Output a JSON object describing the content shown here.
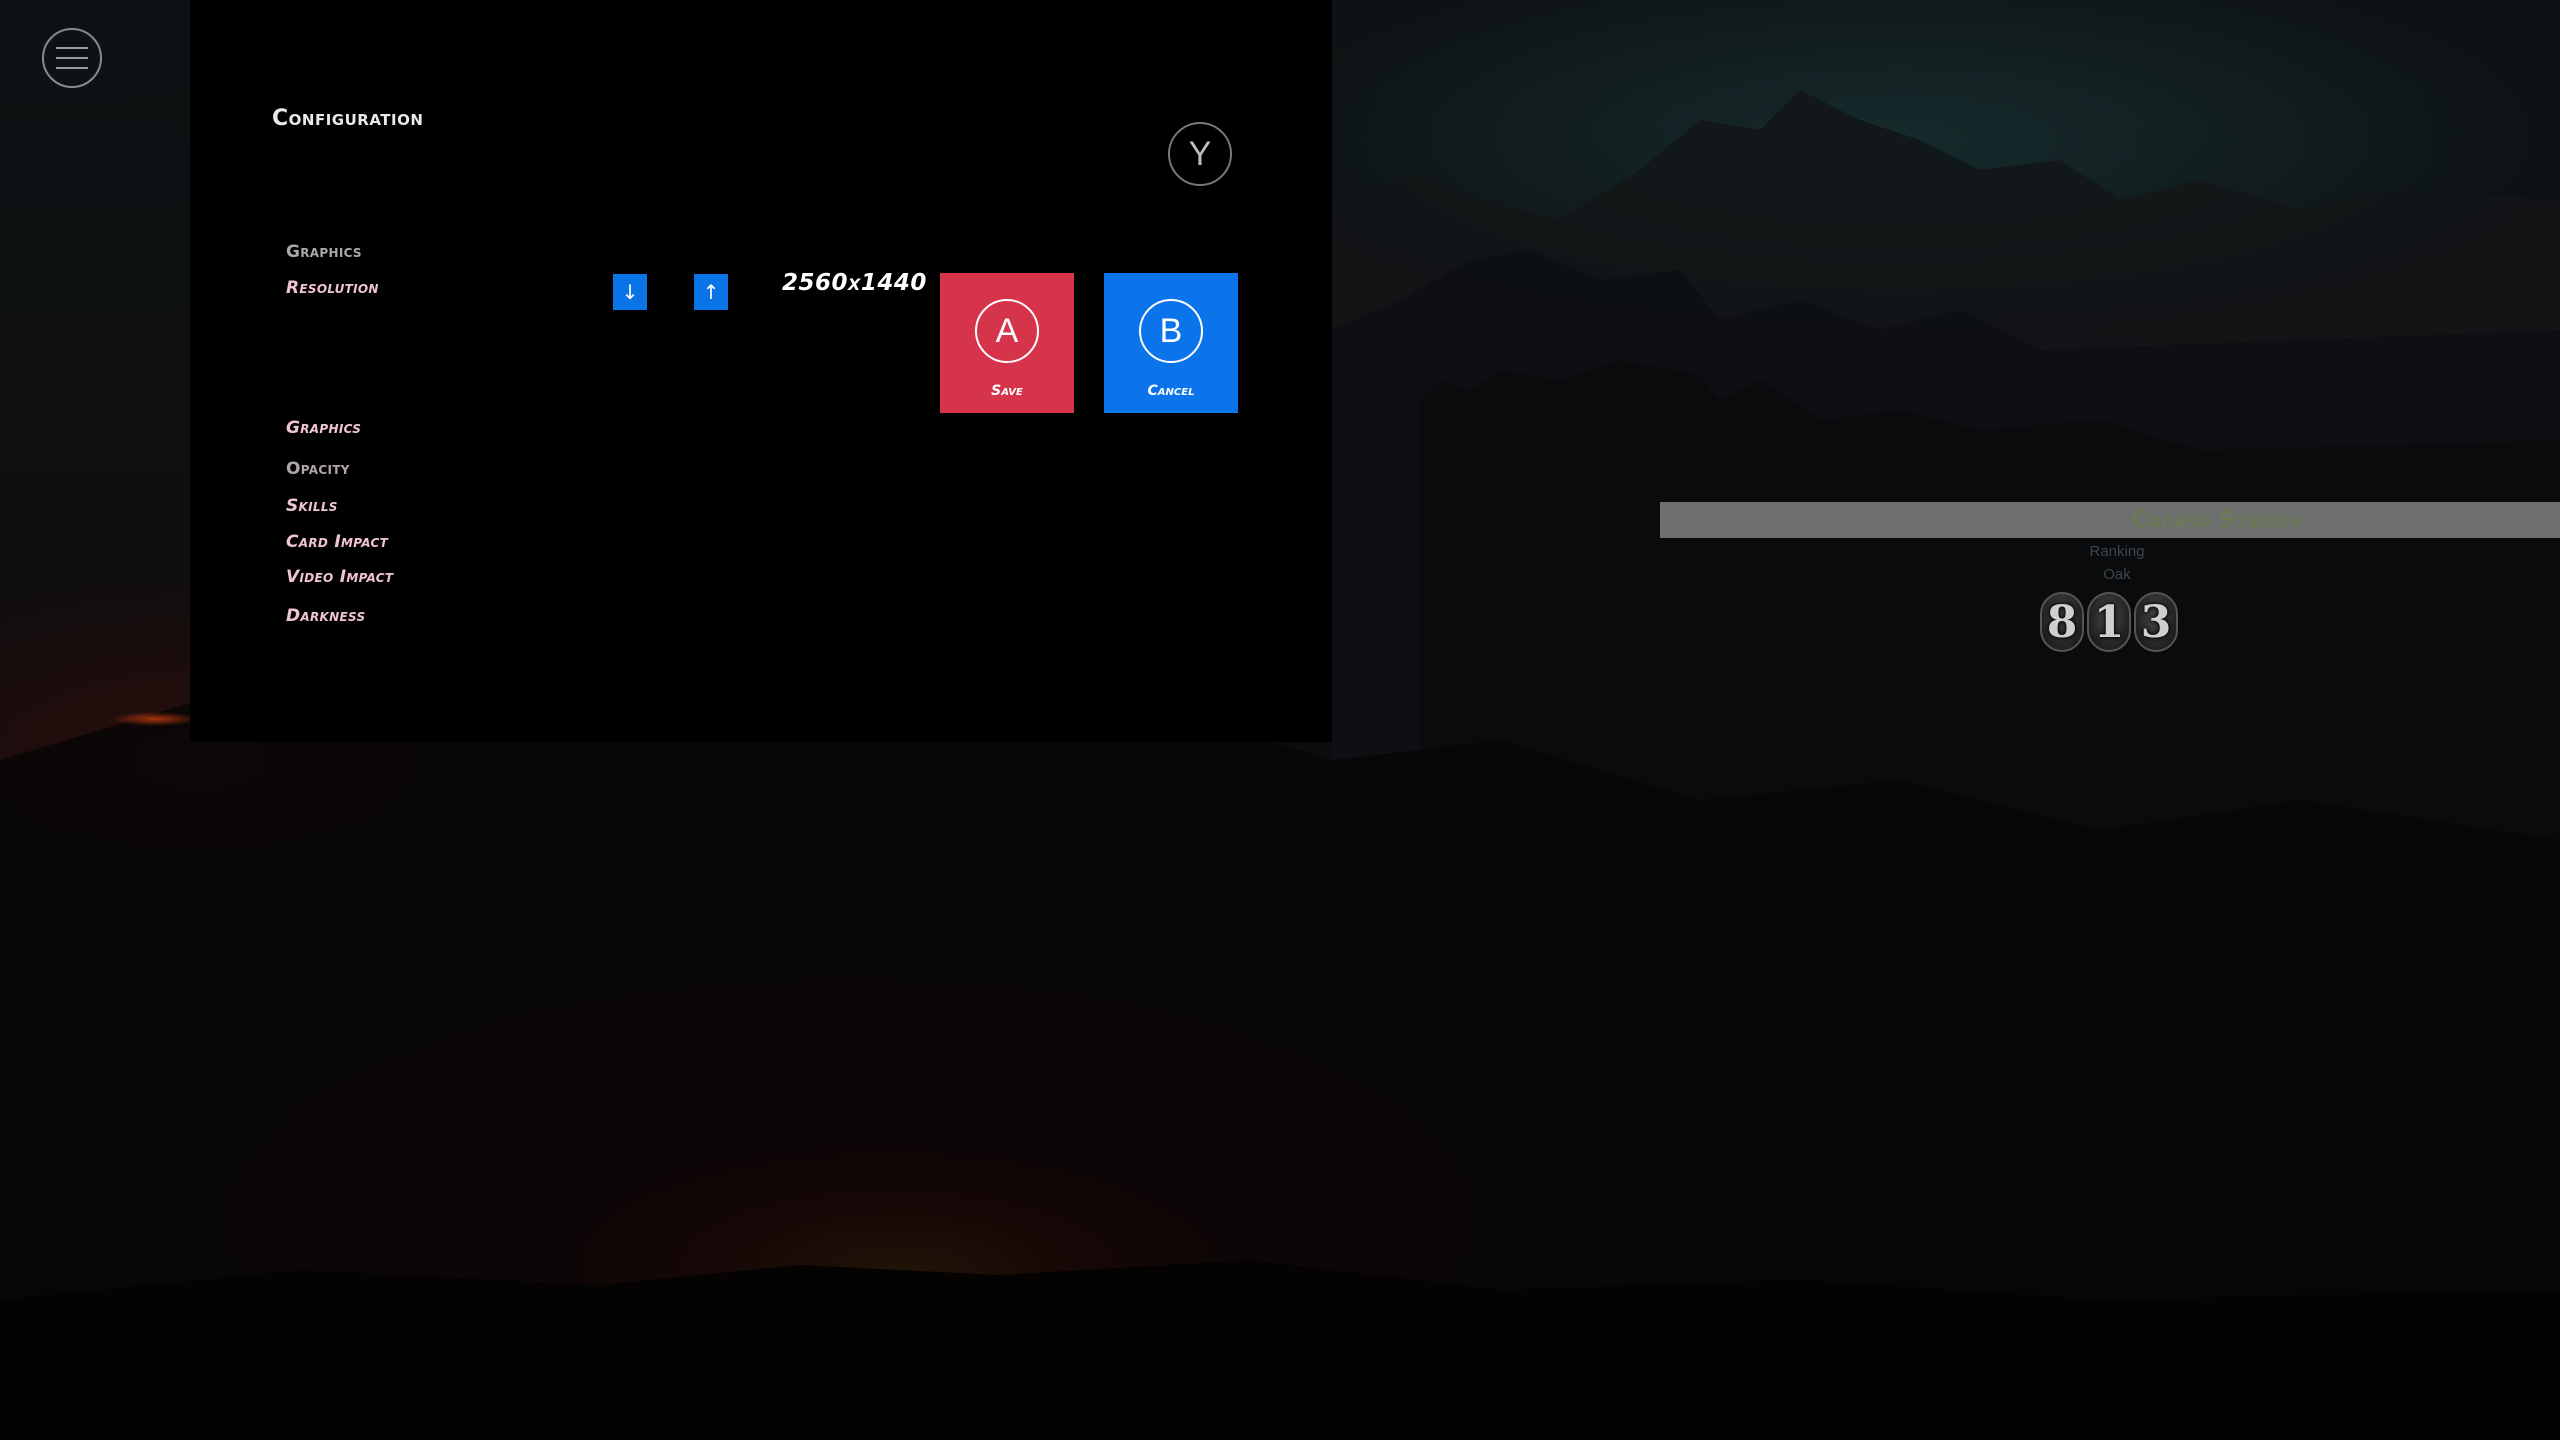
{
  "menu": {
    "icon": "hamburger-menu-icon"
  },
  "config": {
    "title": "Configuration",
    "y_button": "Y",
    "section_header": "Graphics",
    "resolution_label": "Resolution",
    "resolution_value": "2560x1440",
    "decrease_symbol": "↓",
    "increase_symbol": "↑",
    "menu_items": [
      "Graphics",
      "Opacity",
      "Skills",
      "Card Impact",
      "Video Impact",
      "Darkness"
    ]
  },
  "actions": {
    "save": {
      "key": "A",
      "label": "Save",
      "color": "#d6344a"
    },
    "cancel": {
      "key": "B",
      "label": "Cancel",
      "color": "#0b74ea"
    }
  },
  "studio": {
    "name": "Codaso Studios",
    "ranking_label": "Ranking",
    "rank_name": "Oak",
    "score_digits": [
      "8",
      "1",
      "3"
    ]
  },
  "colors": {
    "accent_blue": "#0a74e6",
    "accent_red": "#d6344a",
    "panel_bg": "#000000"
  }
}
